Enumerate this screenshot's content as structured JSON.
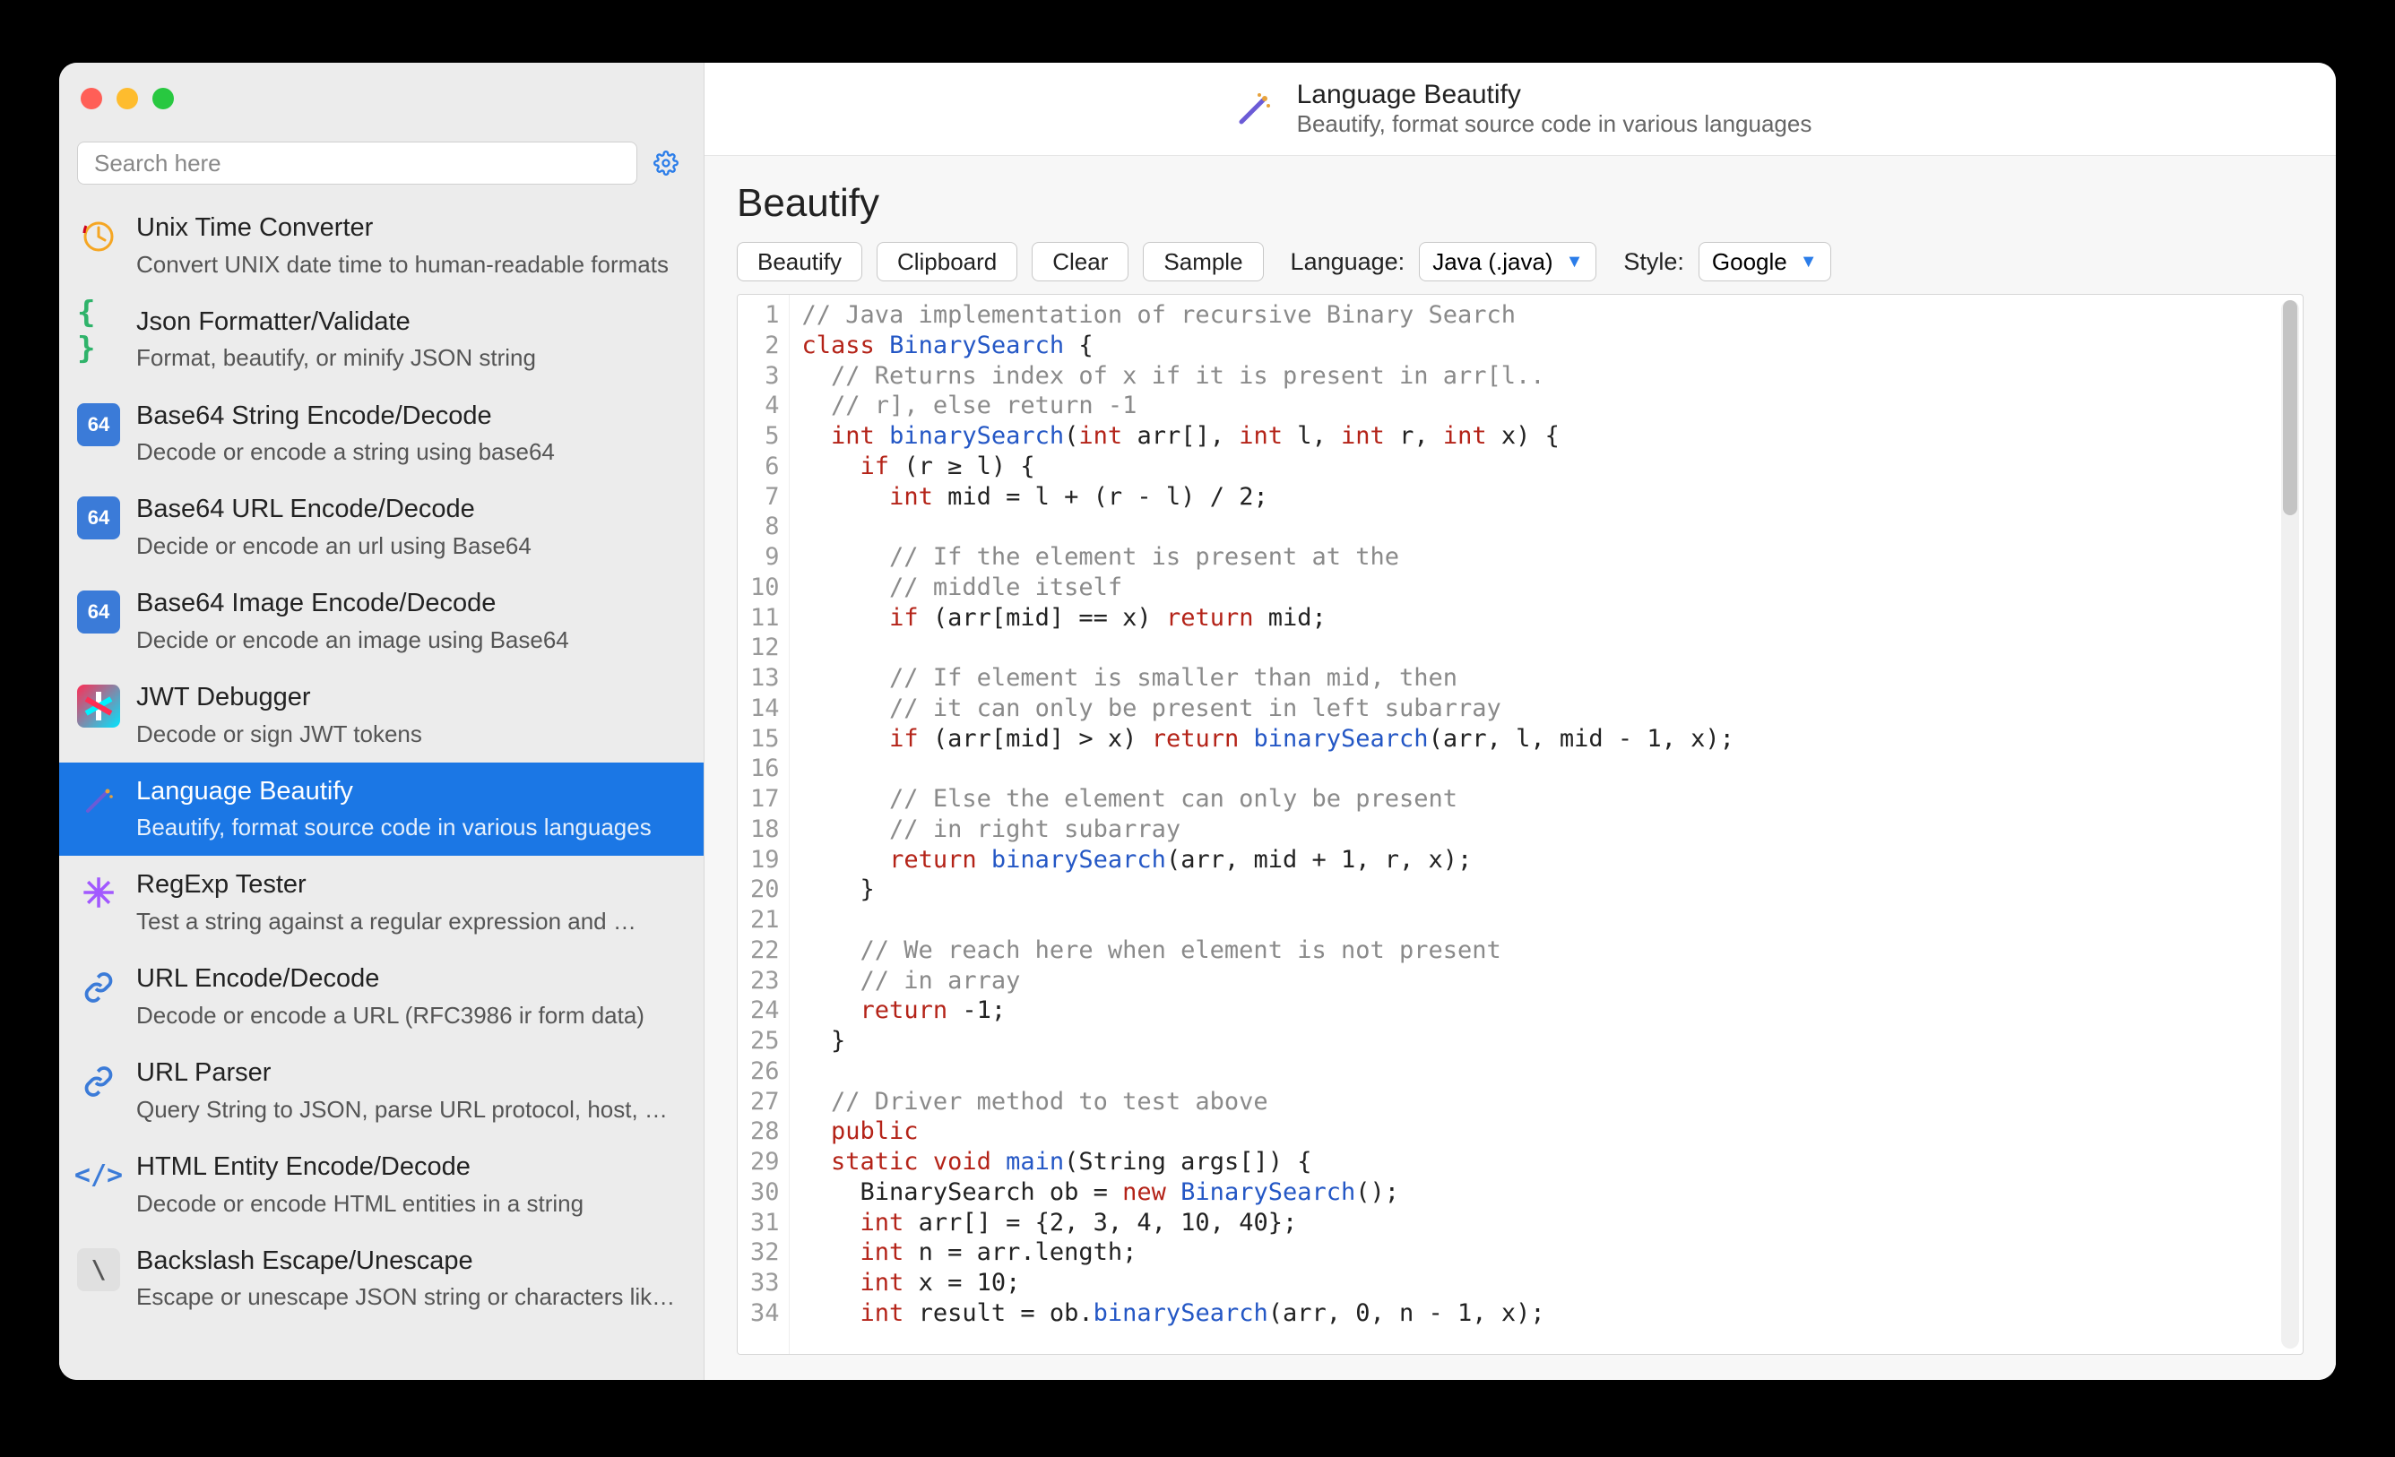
{
  "search": {
    "placeholder": "Search here"
  },
  "sidebar": {
    "items": [
      {
        "title": "Unix Time Converter",
        "desc": "Convert UNIX date time to human-readable formats",
        "icon": "clock"
      },
      {
        "title": "Json Formatter/Validate",
        "desc": "Format, beautify, or minify JSON string",
        "icon": "json"
      },
      {
        "title": "Base64 String Encode/Decode",
        "desc": "Decode or encode a string using base64",
        "icon": "b64"
      },
      {
        "title": "Base64 URL Encode/Decode",
        "desc": "Decide or encode an url using Base64",
        "icon": "b64"
      },
      {
        "title": "Base64 Image Encode/Decode",
        "desc": "Decide or encode an image using Base64",
        "icon": "b64"
      },
      {
        "title": "JWT Debugger",
        "desc": "Decode or sign JWT tokens",
        "icon": "jwt"
      },
      {
        "title": "Language Beautify",
        "desc": "Beautify, format source code in various languages",
        "icon": "wand",
        "selected": true
      },
      {
        "title": "RegExp Tester",
        "desc": "Test a string against a regular expression and …",
        "icon": "regex"
      },
      {
        "title": "URL Encode/Decode",
        "desc": "Decode or encode a URL (RFC3986 ir form data)",
        "icon": "link"
      },
      {
        "title": "URL Parser",
        "desc": "Query String to JSON, parse URL protocol, host, …",
        "icon": "link"
      },
      {
        "title": "HTML Entity Encode/Decode",
        "desc": "Decode or encode HTML entities in a string",
        "icon": "html"
      },
      {
        "title": "Backslash Escape/Unescape",
        "desc": "Escape or unescape JSON string or characters lik…",
        "icon": "esc"
      }
    ]
  },
  "header": {
    "title": "Language Beautify",
    "subtitle": "Beautify, format source code in various languages"
  },
  "page": {
    "title": "Beautify"
  },
  "toolbar": {
    "beautify": "Beautify",
    "clipboard": "Clipboard",
    "clear": "Clear",
    "sample": "Sample",
    "language_label": "Language:",
    "language_value": "Java (.java)",
    "style_label": "Style:",
    "style_value": "Google"
  },
  "code": {
    "line_count": 34,
    "lines": [
      {
        "tokens": [
          {
            "t": "// Java implementation of recursive Binary Search",
            "c": "comment"
          }
        ]
      },
      {
        "tokens": [
          {
            "t": "class ",
            "c": "keyword"
          },
          {
            "t": "BinarySearch ",
            "c": "classname"
          },
          {
            "t": "{",
            "c": "op"
          }
        ]
      },
      {
        "tokens": [
          {
            "t": "  // Returns index of x if it is present in arr[l..",
            "c": "comment"
          }
        ]
      },
      {
        "tokens": [
          {
            "t": "  // r], else return -1",
            "c": "comment"
          }
        ]
      },
      {
        "tokens": [
          {
            "t": "  ",
            "c": "op"
          },
          {
            "t": "int ",
            "c": "keyword"
          },
          {
            "t": "binarySearch",
            "c": "func"
          },
          {
            "t": "(",
            "c": "op"
          },
          {
            "t": "int ",
            "c": "keyword"
          },
          {
            "t": "arr[], ",
            "c": "ident"
          },
          {
            "t": "int ",
            "c": "keyword"
          },
          {
            "t": "l, ",
            "c": "ident"
          },
          {
            "t": "int ",
            "c": "keyword"
          },
          {
            "t": "r, ",
            "c": "ident"
          },
          {
            "t": "int ",
            "c": "keyword"
          },
          {
            "t": "x) {",
            "c": "ident"
          }
        ]
      },
      {
        "tokens": [
          {
            "t": "    ",
            "c": "op"
          },
          {
            "t": "if ",
            "c": "keyword"
          },
          {
            "t": "(r ≥ l) {",
            "c": "ident"
          }
        ]
      },
      {
        "tokens": [
          {
            "t": "      ",
            "c": "op"
          },
          {
            "t": "int ",
            "c": "keyword"
          },
          {
            "t": "mid = l + (r - l) / 2;",
            "c": "ident"
          }
        ]
      },
      {
        "tokens": [
          {
            "t": " ",
            "c": "op"
          }
        ]
      },
      {
        "tokens": [
          {
            "t": "      // If the element is present at the",
            "c": "comment"
          }
        ]
      },
      {
        "tokens": [
          {
            "t": "      // middle itself",
            "c": "comment"
          }
        ]
      },
      {
        "tokens": [
          {
            "t": "      ",
            "c": "op"
          },
          {
            "t": "if ",
            "c": "keyword"
          },
          {
            "t": "(arr[mid] == x) ",
            "c": "ident"
          },
          {
            "t": "return ",
            "c": "keyword"
          },
          {
            "t": "mid;",
            "c": "ident"
          }
        ]
      },
      {
        "tokens": [
          {
            "t": " ",
            "c": "op"
          }
        ]
      },
      {
        "tokens": [
          {
            "t": "      // If element is smaller than mid, then",
            "c": "comment"
          }
        ]
      },
      {
        "tokens": [
          {
            "t": "      // it can only be present in left subarray",
            "c": "comment"
          }
        ]
      },
      {
        "tokens": [
          {
            "t": "      ",
            "c": "op"
          },
          {
            "t": "if ",
            "c": "keyword"
          },
          {
            "t": "(arr[mid] > x) ",
            "c": "ident"
          },
          {
            "t": "return ",
            "c": "keyword"
          },
          {
            "t": "binarySearch",
            "c": "func"
          },
          {
            "t": "(arr, l, mid - 1, x);",
            "c": "ident"
          }
        ]
      },
      {
        "tokens": [
          {
            "t": " ",
            "c": "op"
          }
        ]
      },
      {
        "tokens": [
          {
            "t": "      // Else the element can only be present",
            "c": "comment"
          }
        ]
      },
      {
        "tokens": [
          {
            "t": "      // in right subarray",
            "c": "comment"
          }
        ]
      },
      {
        "tokens": [
          {
            "t": "      ",
            "c": "op"
          },
          {
            "t": "return ",
            "c": "keyword"
          },
          {
            "t": "binarySearch",
            "c": "func"
          },
          {
            "t": "(arr, mid + 1, r, x);",
            "c": "ident"
          }
        ]
      },
      {
        "tokens": [
          {
            "t": "    }",
            "c": "ident"
          }
        ]
      },
      {
        "tokens": [
          {
            "t": " ",
            "c": "op"
          }
        ]
      },
      {
        "tokens": [
          {
            "t": "    // We reach here when element is not present",
            "c": "comment"
          }
        ]
      },
      {
        "tokens": [
          {
            "t": "    // in array",
            "c": "comment"
          }
        ]
      },
      {
        "tokens": [
          {
            "t": "    ",
            "c": "op"
          },
          {
            "t": "return ",
            "c": "keyword"
          },
          {
            "t": "-1;",
            "c": "ident"
          }
        ]
      },
      {
        "tokens": [
          {
            "t": "  }",
            "c": "ident"
          }
        ]
      },
      {
        "tokens": [
          {
            "t": " ",
            "c": "op"
          }
        ]
      },
      {
        "tokens": [
          {
            "t": "  // Driver method to test above",
            "c": "comment"
          }
        ]
      },
      {
        "tokens": [
          {
            "t": "  ",
            "c": "op"
          },
          {
            "t": "public",
            "c": "keyword"
          }
        ]
      },
      {
        "tokens": [
          {
            "t": "  ",
            "c": "op"
          },
          {
            "t": "static ",
            "c": "keyword"
          },
          {
            "t": "void ",
            "c": "keyword"
          },
          {
            "t": "main",
            "c": "func"
          },
          {
            "t": "(String args[]) {",
            "c": "ident"
          }
        ]
      },
      {
        "tokens": [
          {
            "t": "    BinarySearch ob = ",
            "c": "ident"
          },
          {
            "t": "new ",
            "c": "keyword"
          },
          {
            "t": "BinarySearch",
            "c": "func"
          },
          {
            "t": "();",
            "c": "ident"
          }
        ]
      },
      {
        "tokens": [
          {
            "t": "    ",
            "c": "op"
          },
          {
            "t": "int ",
            "c": "keyword"
          },
          {
            "t": "arr[] = {2, 3, 4, 10, 40};",
            "c": "ident"
          }
        ]
      },
      {
        "tokens": [
          {
            "t": "    ",
            "c": "op"
          },
          {
            "t": "int ",
            "c": "keyword"
          },
          {
            "t": "n = arr.length;",
            "c": "ident"
          }
        ]
      },
      {
        "tokens": [
          {
            "t": "    ",
            "c": "op"
          },
          {
            "t": "int ",
            "c": "keyword"
          },
          {
            "t": "x = 10;",
            "c": "ident"
          }
        ]
      },
      {
        "tokens": [
          {
            "t": "    ",
            "c": "op"
          },
          {
            "t": "int ",
            "c": "keyword"
          },
          {
            "t": "result = ob.",
            "c": "ident"
          },
          {
            "t": "binarySearch",
            "c": "func"
          },
          {
            "t": "(arr, 0, n - 1, x);",
            "c": "ident"
          }
        ]
      }
    ]
  }
}
